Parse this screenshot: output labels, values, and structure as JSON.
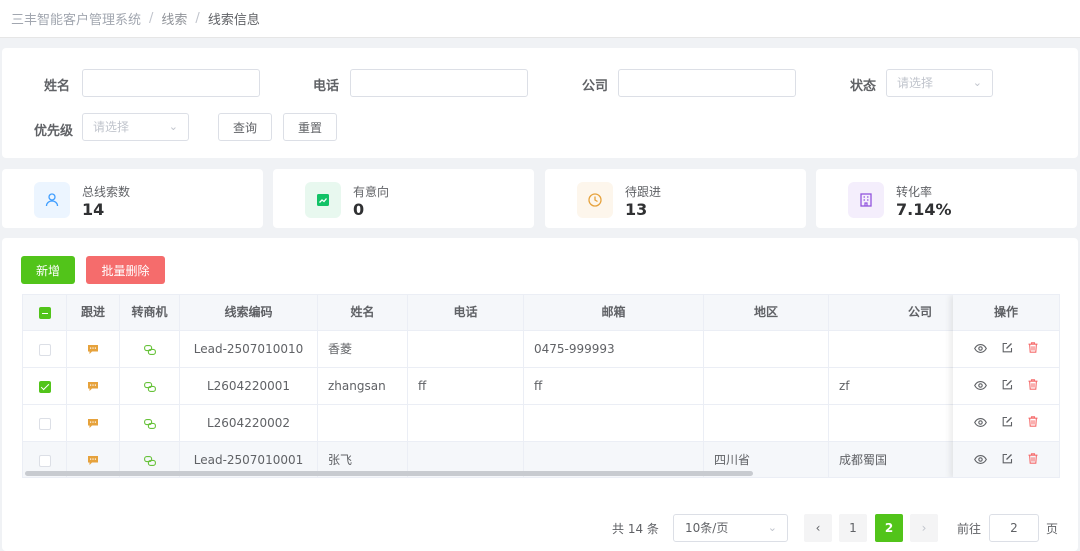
{
  "breadcrumb": [
    "三丰智能客户管理系统",
    "线索",
    "线索信息"
  ],
  "search": {
    "name_label": "姓名",
    "phone_label": "电话",
    "company_label": "公司",
    "status_label": "状态",
    "status_placeholder": "请选择",
    "priority_label": "优先级",
    "priority_placeholder": "请选择",
    "query_label": "查询",
    "reset_label": "重置"
  },
  "stats": [
    {
      "label": "总线索数",
      "value": "14",
      "icon": "user-icon",
      "color": "#409eff"
    },
    {
      "label": "有意向",
      "value": "0",
      "icon": "trend-up-icon",
      "color": "#13c267"
    },
    {
      "label": "待跟进",
      "value": "13",
      "icon": "clock-icon",
      "color": "#e6a23c"
    },
    {
      "label": "转化率",
      "value": "7.14%",
      "icon": "building-icon",
      "color": "#9254de"
    }
  ],
  "toolbar": {
    "add_label": "新增",
    "batch_delete_label": "批量删除"
  },
  "table": {
    "headers": [
      "跟进",
      "转商机",
      "线索编码",
      "姓名",
      "电话",
      "邮箱",
      "地区",
      "公司",
      "操作"
    ],
    "rows": [
      {
        "checked": false,
        "code": "Lead-2507010010",
        "name": "香菱",
        "phone": "",
        "email": "0475-999993",
        "region": "",
        "company": ""
      },
      {
        "checked": true,
        "code": "L2604220001",
        "name": "zhangsan",
        "phone": "ff",
        "email": "ff",
        "region": "",
        "company": "zf"
      },
      {
        "checked": false,
        "code": "L2604220002",
        "name": "",
        "phone": "",
        "email": "",
        "region": "",
        "company": ""
      },
      {
        "checked": false,
        "code": "Lead-2507010001",
        "name": "张飞",
        "phone": "",
        "email": "",
        "region": "四川省",
        "company": "成都蜀国"
      }
    ]
  },
  "pagination": {
    "total": "共 14 条",
    "page_size": "10条/页",
    "pages": [
      "1",
      "2"
    ],
    "current": "2",
    "goto_label": "前往",
    "goto_value": "2",
    "page_unit": "页"
  },
  "colors": {
    "primary": "#52c41a",
    "danger": "#f56c6c",
    "follow_icon": "#e6a23c",
    "convert_icon": "#67c23a"
  }
}
